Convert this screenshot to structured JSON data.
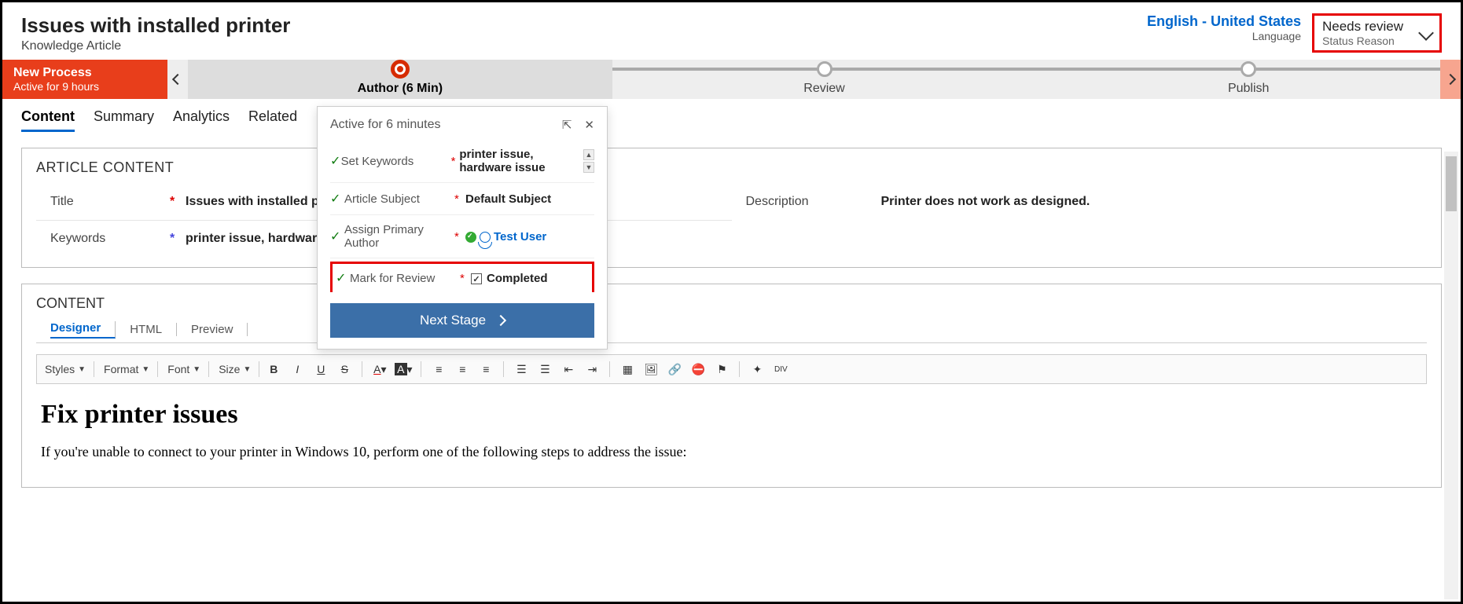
{
  "header": {
    "title": "Issues with installed printer",
    "subtitle": "Knowledge Article",
    "language": "English - United States",
    "language_label": "Language",
    "status": "Needs review",
    "status_label": "Status Reason"
  },
  "process": {
    "name": "New Process",
    "duration": "Active for 9 hours",
    "stages": [
      {
        "label": "Author  (6 Min)",
        "active": true
      },
      {
        "label": "Review",
        "active": false
      },
      {
        "label": "Publish",
        "active": false
      }
    ]
  },
  "tabs": [
    "Content",
    "Summary",
    "Analytics",
    "Related"
  ],
  "article": {
    "section_title": "ARTICLE CONTENT",
    "title_label": "Title",
    "title_value": "Issues with installed printer",
    "keywords_label": "Keywords",
    "keywords_value": "printer issue, hardware issue",
    "description_label": "Description",
    "description_value": "Printer does not work as designed."
  },
  "content": {
    "section_title": "CONTENT",
    "editor_tabs": [
      "Designer",
      "HTML",
      "Preview"
    ],
    "toolbar": {
      "styles": "Styles",
      "format": "Format",
      "font": "Font",
      "size": "Size"
    },
    "doc_heading": "Fix printer issues",
    "doc_body": "If you're unable to connect to your printer in Windows 10, perform one of the following steps to address the issue:"
  },
  "popout": {
    "header": "Active for 6 minutes",
    "rows": {
      "keywords_label": "Set Keywords",
      "keywords_value": "printer issue, hardware issue",
      "subject_label": "Article Subject",
      "subject_value": "Default Subject",
      "author_label": "Assign Primary Author",
      "author_value": "Test User",
      "review_label": "Mark for Review",
      "review_value": "Completed"
    },
    "next_button": "Next Stage"
  }
}
